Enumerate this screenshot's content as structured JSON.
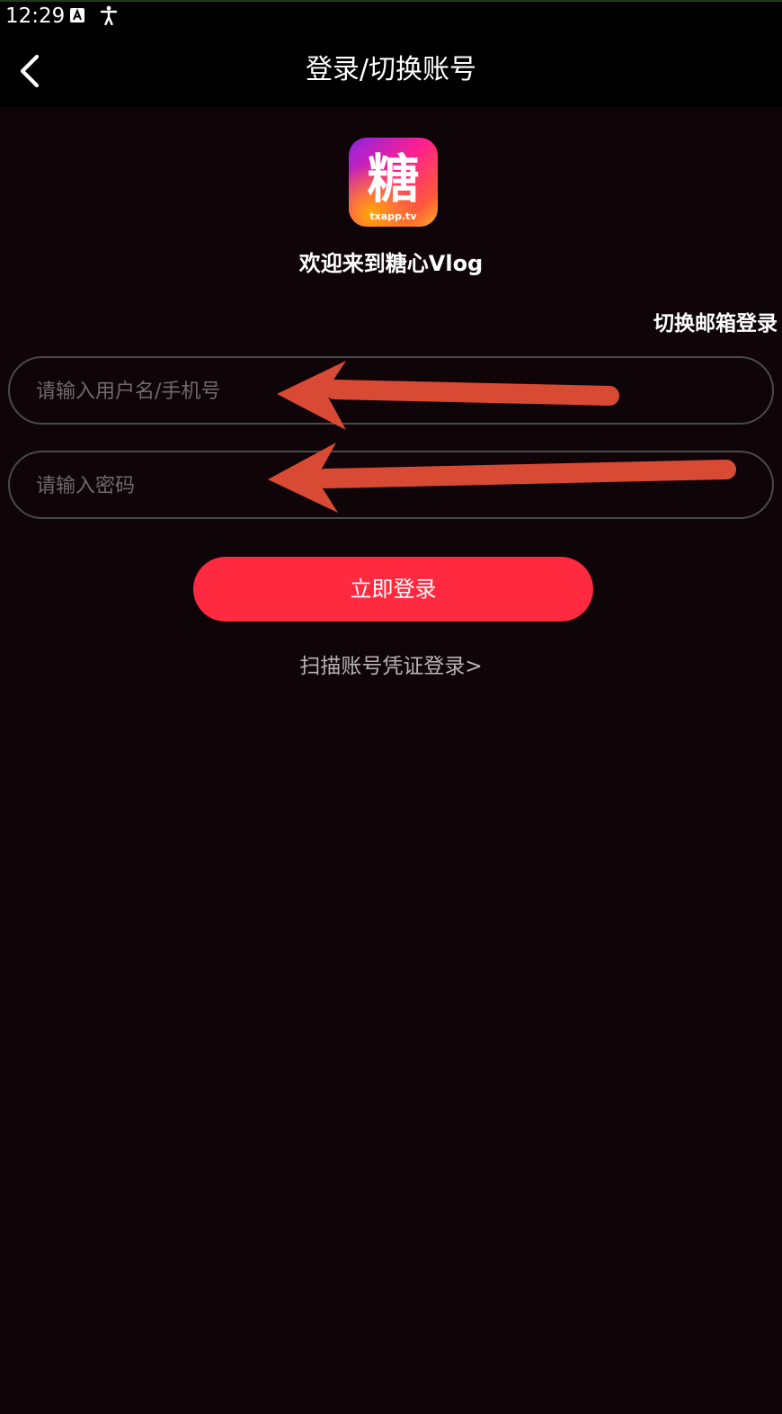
{
  "status_bar": {
    "time": "12:29",
    "icons": [
      "a-notification-icon",
      "accessibility-icon"
    ]
  },
  "header": {
    "title": "登录/切换账号",
    "back_icon": "chevron-left-icon"
  },
  "logo": {
    "character": "糖",
    "domain": "txapp.tv"
  },
  "welcome_text": "欢迎来到糖心Vlog",
  "switch_email_label": "切换邮箱登录",
  "form": {
    "username_placeholder": "请输入用户名/手机号",
    "username_value": "",
    "password_placeholder": "请输入密码",
    "password_value": ""
  },
  "login_button_label": "立即登录",
  "scan_credential_link": "扫描账号凭证登录>",
  "colors": {
    "background": "#0f0508",
    "header_background": "#000000",
    "accent": "#ff2a3f",
    "annotation_arrow": "#d94a35",
    "field_border": "#4a4a4a",
    "placeholder": "#6e6a6b"
  }
}
